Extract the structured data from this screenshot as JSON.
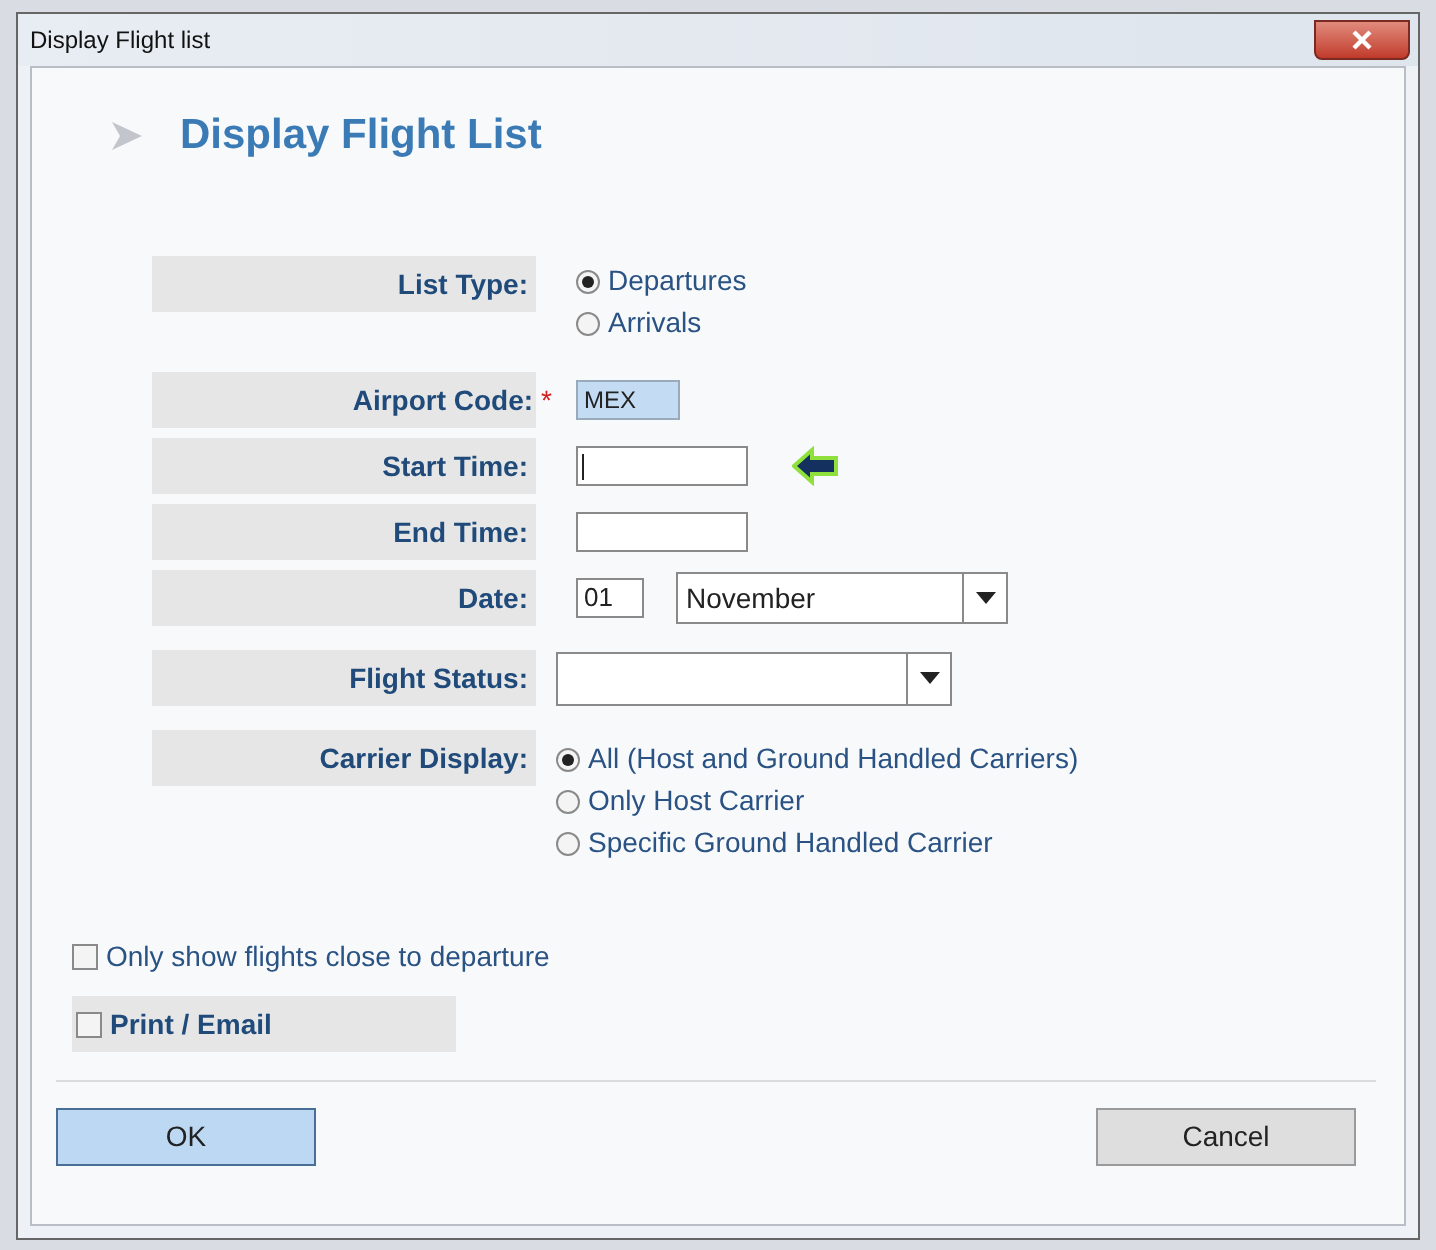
{
  "window": {
    "title": "Display Flight list"
  },
  "heading": "Display Flight List",
  "list_type": {
    "label": "List Type:",
    "options": [
      {
        "label": "Departures",
        "selected": true
      },
      {
        "label": "Arrivals",
        "selected": false
      }
    ]
  },
  "airport_code": {
    "label": "Airport Code:",
    "required_mark": "*",
    "value": "MEX"
  },
  "start_time": {
    "label": "Start Time:",
    "focused": true
  },
  "end_time": {
    "label": "End Time:"
  },
  "date": {
    "label": "Date:",
    "day": "01",
    "month": "November"
  },
  "flight_status": {
    "label": "Flight Status:"
  },
  "carrier_display": {
    "label": "Carrier Display:",
    "options": [
      {
        "label": "All (Host and Ground Handled Carriers)",
        "selected": true
      },
      {
        "label": "Only Host Carrier",
        "selected": false
      },
      {
        "label": "Specific Ground Handled Carrier",
        "selected": false
      }
    ]
  },
  "close_to_departure": {
    "label": "Only show flights close to departure",
    "checked": false
  },
  "print_email": {
    "label": "Print / Email",
    "checked": false
  },
  "buttons": [
    {
      "label": "OK",
      "kind": "primary"
    },
    {
      "label": "Cancel",
      "kind": "secondary"
    }
  ]
}
